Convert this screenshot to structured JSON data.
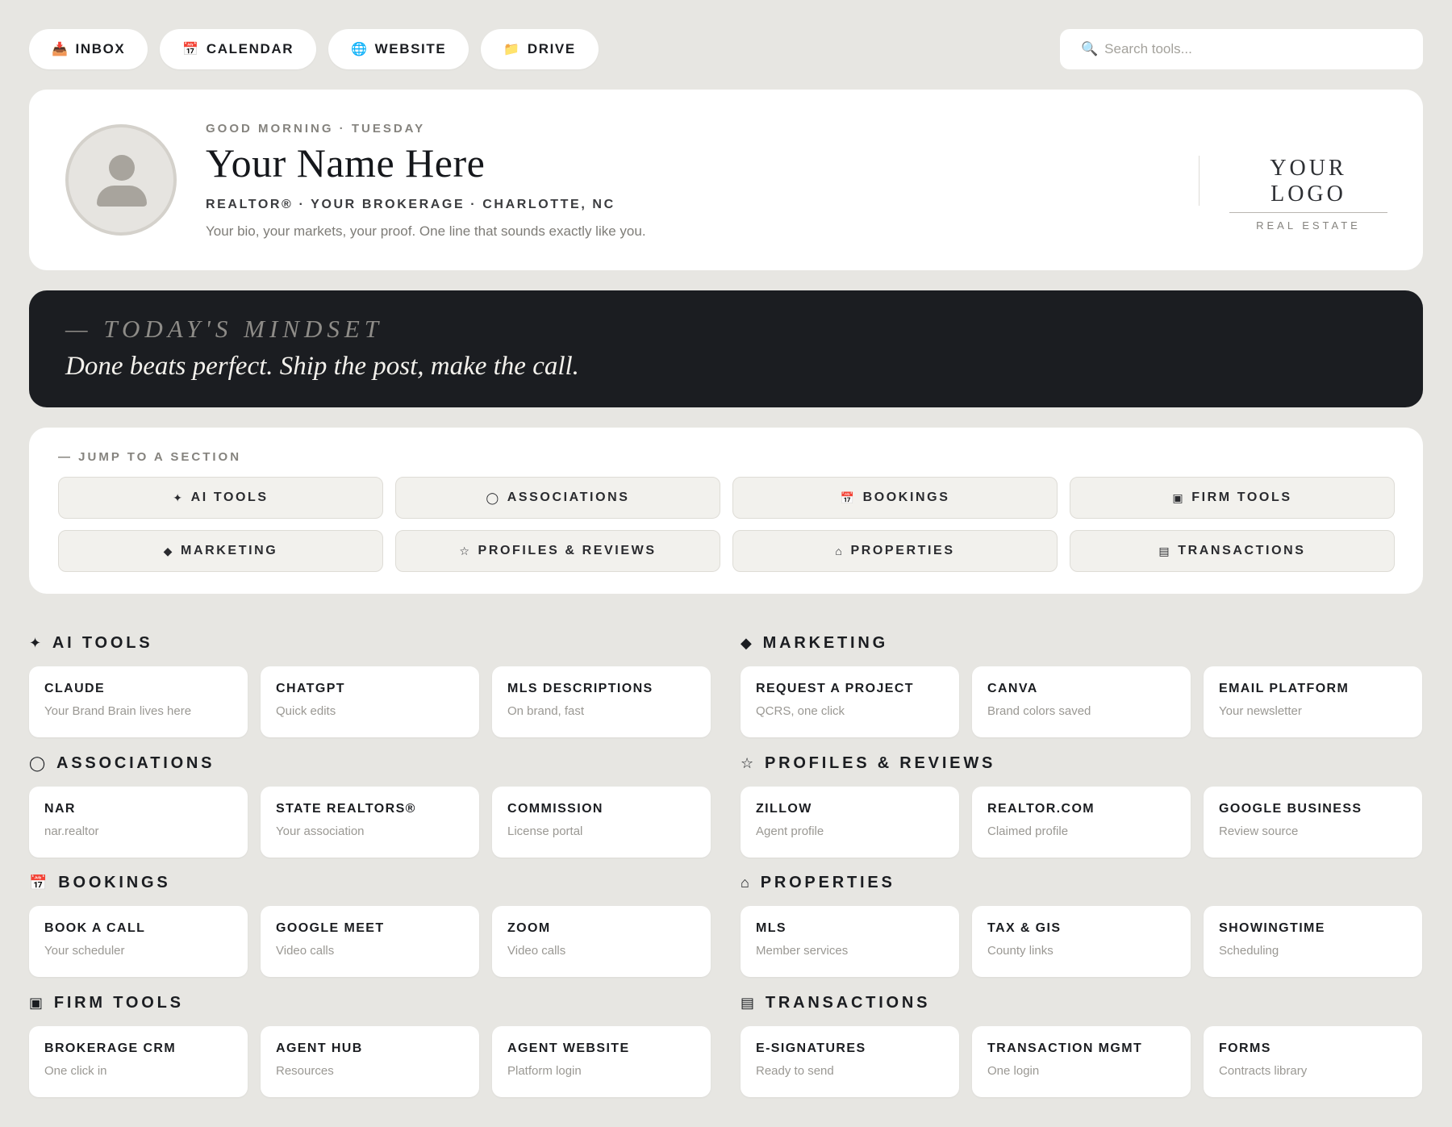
{
  "topbar": {
    "pills": [
      {
        "icon": "inbox-tray-icon",
        "glyph": "📥",
        "label": "INBOX"
      },
      {
        "icon": "calendar-icon",
        "glyph": "📅",
        "label": "CALENDAR"
      },
      {
        "icon": "globe-icon",
        "glyph": "🌐",
        "label": "WEBSITE"
      },
      {
        "icon": "folder-icon",
        "glyph": "📁",
        "label": "DRIVE"
      }
    ],
    "search": {
      "glyph": "🔍",
      "placeholder": "Search tools...",
      "value": ""
    }
  },
  "profile": {
    "greeting": "GOOD MORNING · TUESDAY",
    "name": "Your Name Here",
    "title": "REALTOR® · YOUR BROKERAGE · CHARLOTTE, NC",
    "bio": "Your bio, your markets, your proof. One line that sounds exactly like you.",
    "logo_main": "YOUR LOGO",
    "logo_sub": "REAL ESTATE"
  },
  "mindset": {
    "label": "— TODAY'S MINDSET",
    "quote": "Done beats perfect. Ship the post, make the call."
  },
  "jump": {
    "heading": "— JUMP TO A SECTION",
    "buttons": [
      {
        "glyph": "✦",
        "label": "AI TOOLS"
      },
      {
        "glyph": "◯",
        "label": "ASSOCIATIONS"
      },
      {
        "glyph": "📅",
        "label": "BOOKINGS"
      },
      {
        "glyph": "▣",
        "label": "FIRM TOOLS"
      },
      {
        "glyph": "◆",
        "label": "MARKETING"
      },
      {
        "glyph": "☆",
        "label": "PROFILES & REVIEWS"
      },
      {
        "glyph": "⌂",
        "label": "PROPERTIES"
      },
      {
        "glyph": "▤",
        "label": "TRANSACTIONS"
      }
    ]
  },
  "sections": [
    {
      "glyph": "✦",
      "title": "AI TOOLS",
      "cards": [
        {
          "title": "CLAUDE",
          "sub": "Your Brand Brain lives here"
        },
        {
          "title": "CHATGPT",
          "sub": "Quick edits"
        },
        {
          "title": "MLS DESCRIPTIONS",
          "sub": "On brand, fast"
        }
      ]
    },
    {
      "glyph": "◆",
      "title": "MARKETING",
      "cards": [
        {
          "title": "REQUEST A PROJECT",
          "sub": "QCRS, one click"
        },
        {
          "title": "CANVA",
          "sub": "Brand colors saved"
        },
        {
          "title": "EMAIL PLATFORM",
          "sub": "Your newsletter"
        }
      ]
    },
    {
      "glyph": "◯",
      "title": "ASSOCIATIONS",
      "cards": [
        {
          "title": "NAR",
          "sub": "nar.realtor"
        },
        {
          "title": "STATE REALTORS®",
          "sub": "Your association"
        },
        {
          "title": "COMMISSION",
          "sub": "License portal"
        }
      ]
    },
    {
      "glyph": "☆",
      "title": "PROFILES & REVIEWS",
      "cards": [
        {
          "title": "ZILLOW",
          "sub": "Agent profile"
        },
        {
          "title": "REALTOR.COM",
          "sub": "Claimed profile"
        },
        {
          "title": "GOOGLE BUSINESS",
          "sub": "Review source"
        }
      ]
    },
    {
      "glyph": "📅",
      "title": "BOOKINGS",
      "cards": [
        {
          "title": "BOOK A CALL",
          "sub": "Your scheduler"
        },
        {
          "title": "GOOGLE MEET",
          "sub": "Video calls"
        },
        {
          "title": "ZOOM",
          "sub": "Video calls"
        }
      ]
    },
    {
      "glyph": "⌂",
      "title": "PROPERTIES",
      "cards": [
        {
          "title": "MLS",
          "sub": "Member services"
        },
        {
          "title": "TAX & GIS",
          "sub": "County links"
        },
        {
          "title": "SHOWINGTIME",
          "sub": "Scheduling"
        }
      ]
    },
    {
      "glyph": "▣",
      "title": "FIRM TOOLS",
      "cards": [
        {
          "title": "BROKERAGE CRM",
          "sub": "One click in"
        },
        {
          "title": "AGENT HUB",
          "sub": "Resources"
        },
        {
          "title": "AGENT WEBSITE",
          "sub": "Platform login"
        }
      ]
    },
    {
      "glyph": "▤",
      "title": "TRANSACTIONS",
      "cards": [
        {
          "title": "E-SIGNATURES",
          "sub": "Ready to send"
        },
        {
          "title": "TRANSACTION MGMT",
          "sub": "One login"
        },
        {
          "title": "FORMS",
          "sub": "Contracts library"
        }
      ]
    }
  ]
}
